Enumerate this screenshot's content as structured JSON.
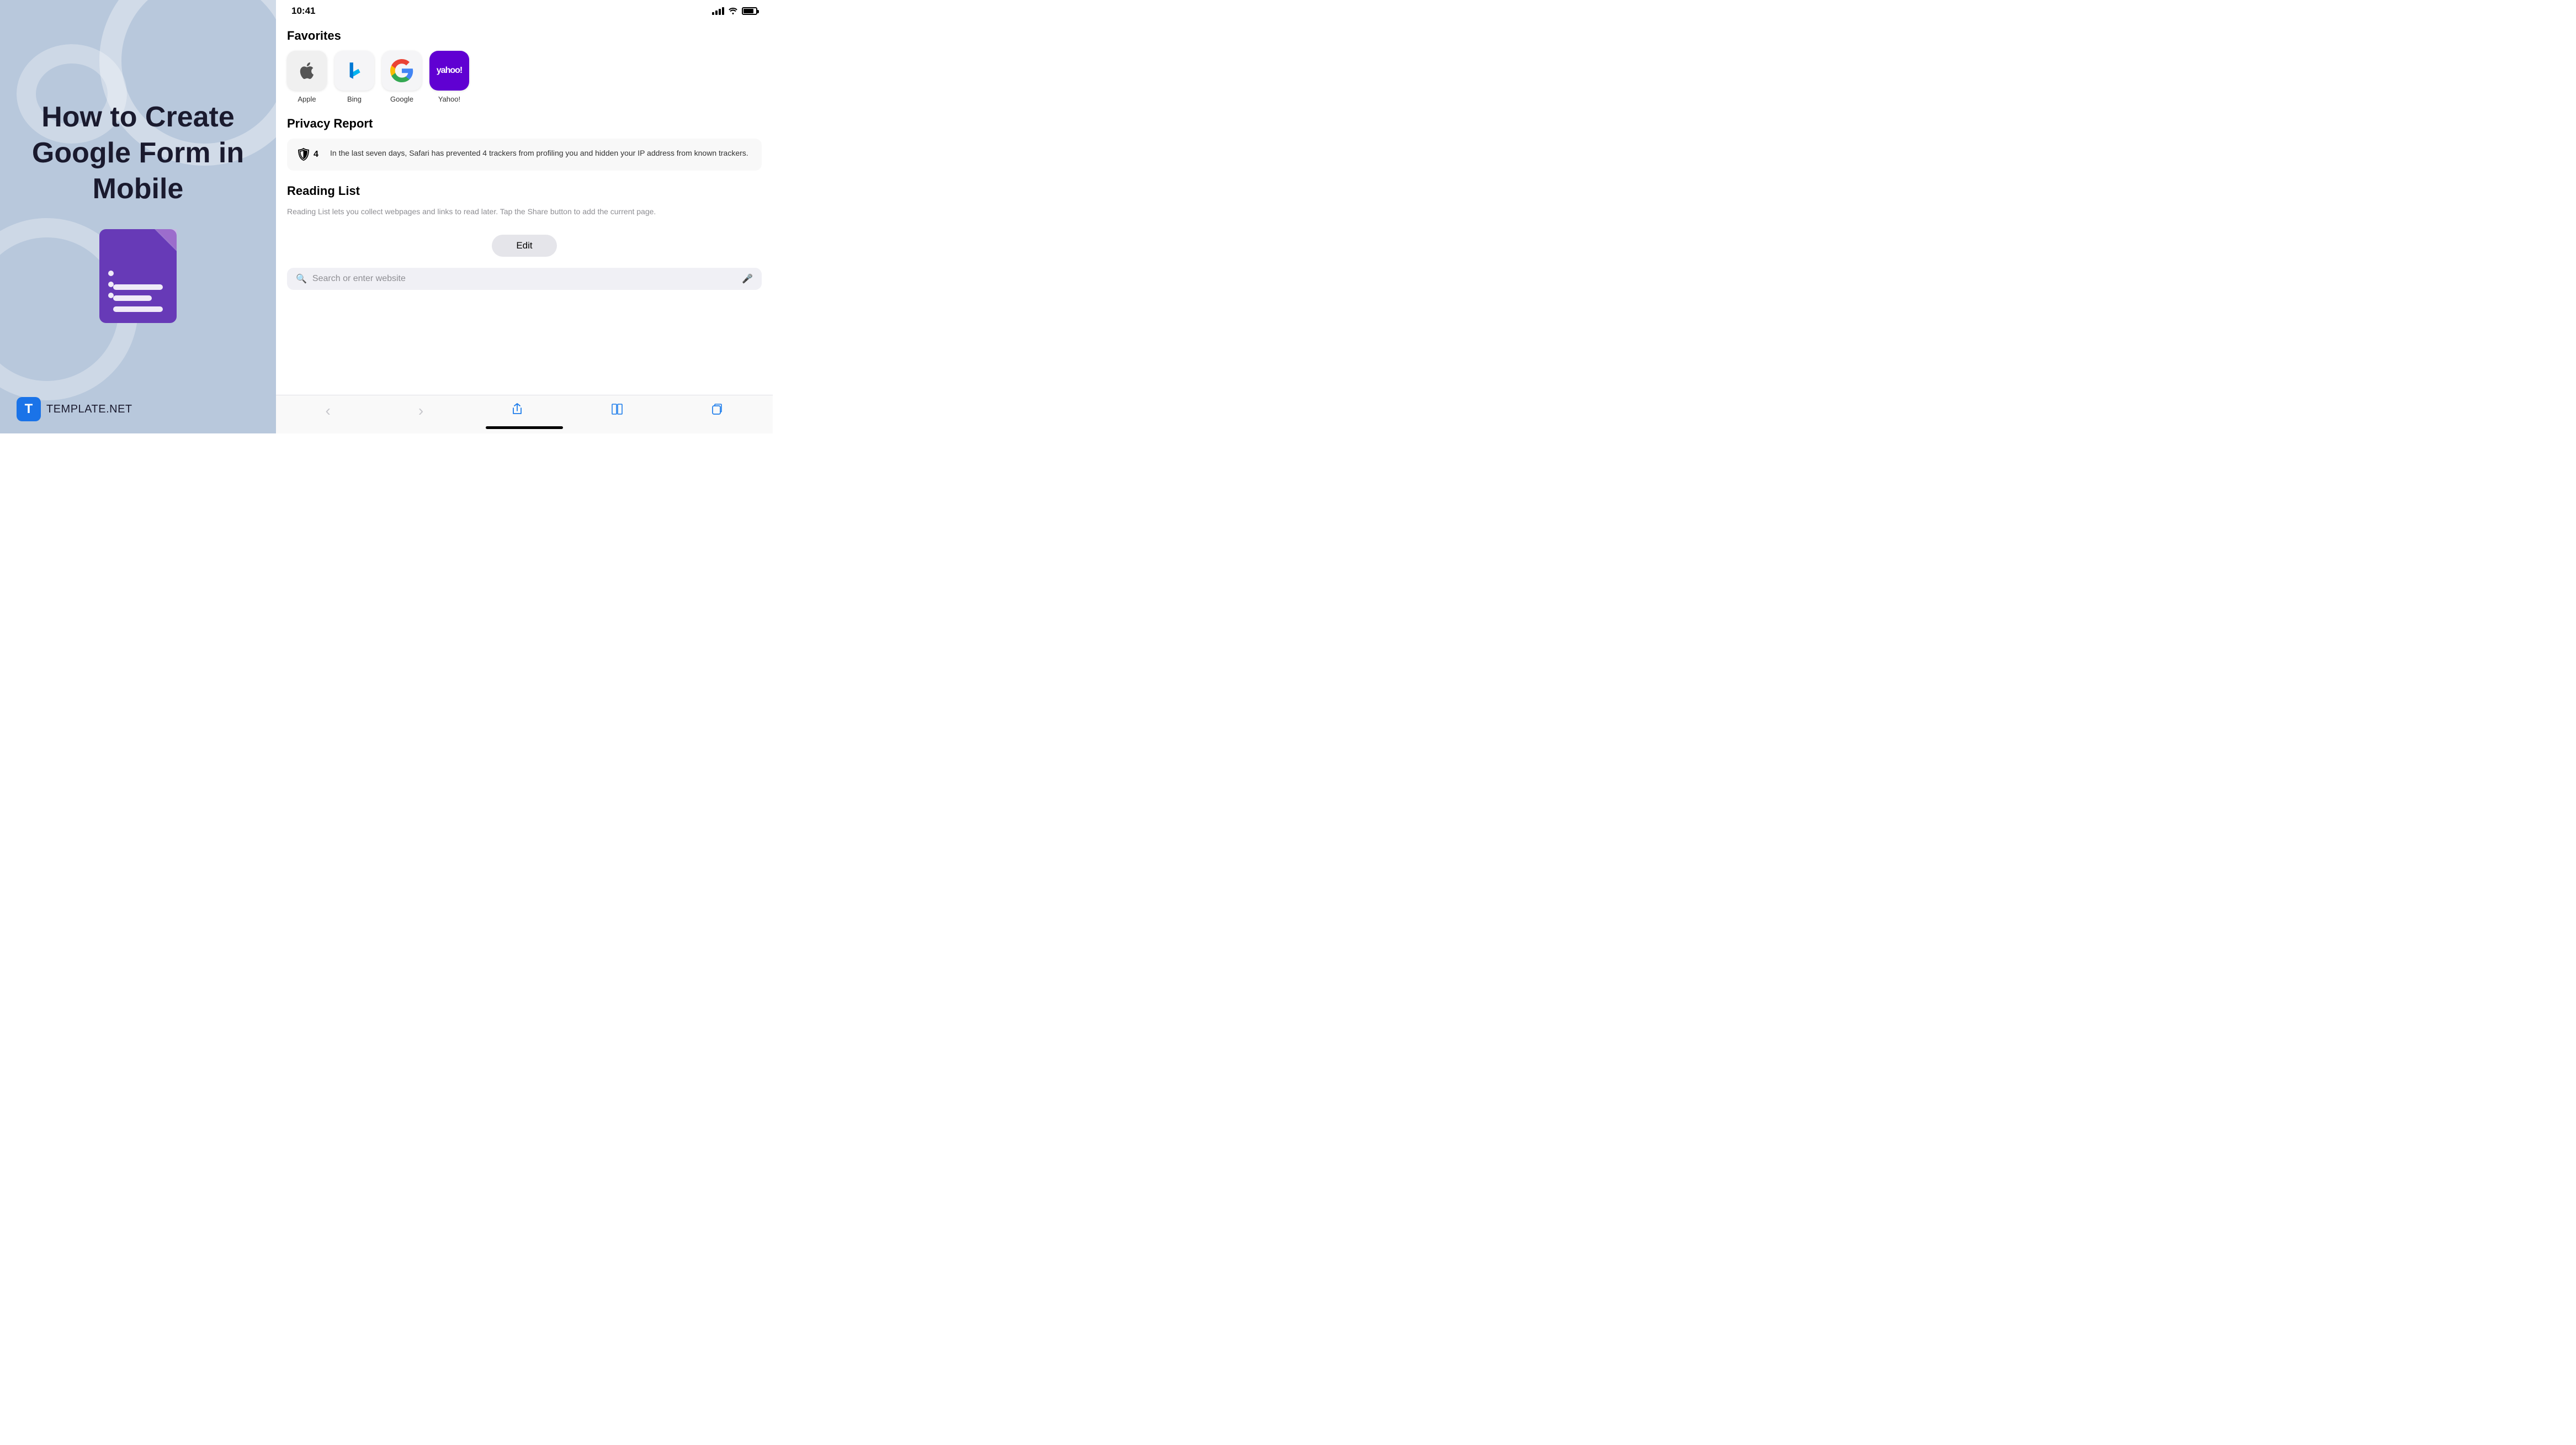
{
  "left": {
    "title": "How to Create Google Form in Mobile",
    "logo": {
      "letter": "T",
      "brand": "TEMPLATE",
      "suffix": ".NET"
    }
  },
  "safari": {
    "statusBar": {
      "time": "10:41"
    },
    "favorites": {
      "sectionTitle": "Favorites",
      "items": [
        {
          "name": "Apple",
          "icon": "apple"
        },
        {
          "name": "Bing",
          "icon": "bing"
        },
        {
          "name": "Google",
          "icon": "google"
        },
        {
          "name": "Yahoo!",
          "icon": "yahoo"
        }
      ]
    },
    "privacyReport": {
      "sectionTitle": "Privacy Report",
      "badgeCount": "4",
      "text": "In the last seven days, Safari has prevented 4 trackers from profiling you and hidden your IP address from known trackers."
    },
    "readingList": {
      "sectionTitle": "Reading List",
      "text": "Reading List lets you collect webpages and links to read later. Tap the Share button to add the current page."
    },
    "editButton": "Edit",
    "searchBar": {
      "placeholder": "Search or enter website"
    },
    "toolbar": {
      "back": "‹",
      "forward": "›",
      "share": "share",
      "bookmarks": "bookmarks",
      "tabs": "tabs"
    }
  }
}
